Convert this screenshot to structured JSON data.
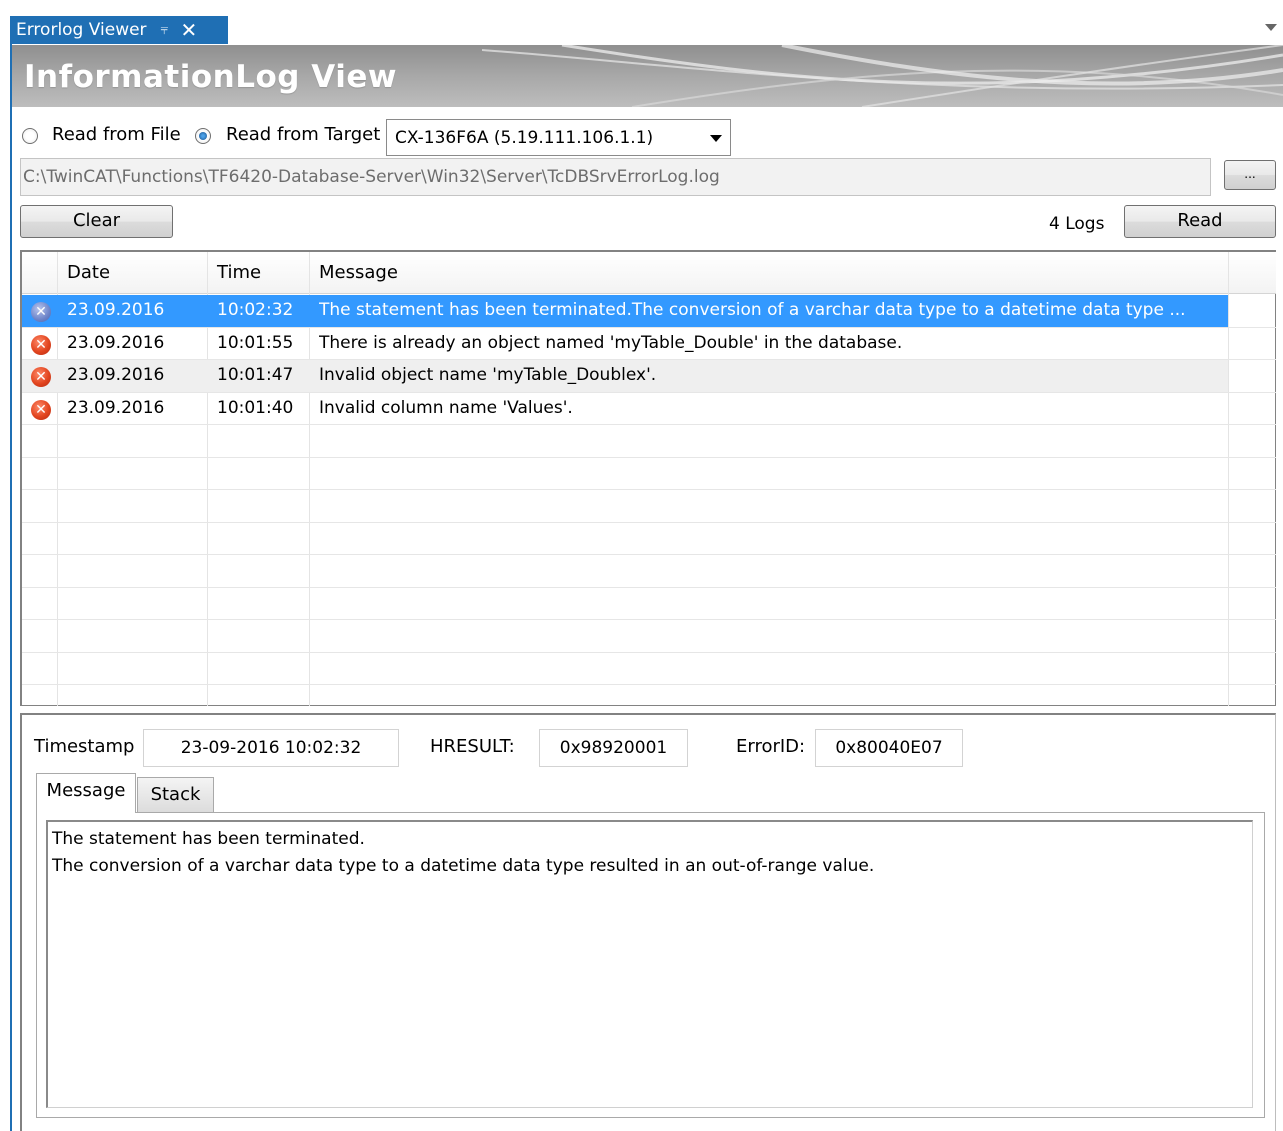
{
  "window": {
    "tab_title": "Errorlog Viewer",
    "pin_icon": "pin-icon",
    "close_icon": "close-icon",
    "banner_title": "InformationLog View",
    "accent_color": "#1f6fb4"
  },
  "source": {
    "read_from_file_label": "Read from File",
    "read_from_target_label": "Read from Target",
    "selected_mode": "Read from Target",
    "target_value": "CX-136F6A (5.19.111.106.1.1)",
    "file_path": "C:\\TwinCAT\\Functions\\TF6420-Database-Server\\Win32\\Server\\TcDBSrvErrorLog.log",
    "browse_label": "..."
  },
  "toolbar": {
    "clear_label": "Clear",
    "log_count": "4 Logs",
    "read_label": "Read"
  },
  "grid": {
    "columns": [
      "Date",
      "Time",
      "Message"
    ],
    "rows": [
      {
        "date": "23.09.2016",
        "time": "10:02:32",
        "message": "The statement has been terminated.The conversion of a varchar data type to a datetime data type ...",
        "selected": true
      },
      {
        "date": "23.09.2016",
        "time": "10:01:55",
        "message": "There is already an object named 'myTable_Double' in the database.",
        "selected": false
      },
      {
        "date": "23.09.2016",
        "time": "10:01:47",
        "message": "Invalid object name 'myTable_Doublex'.",
        "selected": false
      },
      {
        "date": "23.09.2016",
        "time": "10:01:40",
        "message": "Invalid column name 'Values'.",
        "selected": false
      }
    ]
  },
  "details": {
    "timestamp_label": "Timestamp",
    "timestamp_value": "23-09-2016 10:02:32",
    "hresult_label": "HRESULT:",
    "hresult_value": "0x98920001",
    "errorid_label": "ErrorID:",
    "errorid_value": "0x80040E07",
    "tabs": [
      "Message",
      "Stack"
    ],
    "active_tab": "Message",
    "message_text": "The statement has been terminated.\nThe conversion of a varchar data type to a datetime data type resulted in an out-of-range value."
  }
}
